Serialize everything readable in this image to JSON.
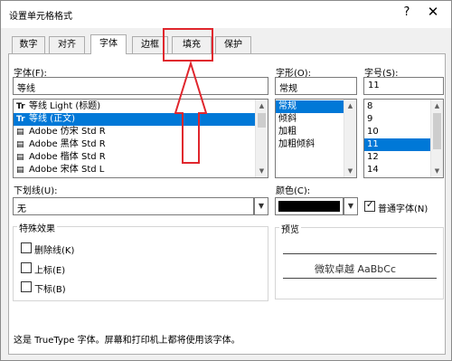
{
  "dialog": {
    "title": "设置单元格格式",
    "help": "?",
    "close": "✕"
  },
  "tabs": [
    {
      "label": "数字"
    },
    {
      "label": "对齐"
    },
    {
      "label": "字体"
    },
    {
      "label": "边框"
    },
    {
      "label": "填充"
    },
    {
      "label": "保护"
    }
  ],
  "font": {
    "label": "字体(F):",
    "value": "等线",
    "items": [
      {
        "glyph": "Tr",
        "label": "等线 Light (标题)"
      },
      {
        "glyph": "Tr",
        "label": "等线 (正文)"
      },
      {
        "glyph": "▤",
        "label": "Adobe 仿宋 Std R"
      },
      {
        "glyph": "▤",
        "label": "Adobe 黑体 Std R"
      },
      {
        "glyph": "▤",
        "label": "Adobe 楷体 Std R"
      },
      {
        "glyph": "▤",
        "label": "Adobe 宋体 Std L"
      }
    ]
  },
  "style": {
    "label": "字形(O):",
    "value": "常规",
    "items": [
      {
        "label": "常规"
      },
      {
        "label": "倾斜"
      },
      {
        "label": "加粗"
      },
      {
        "label": "加粗倾斜"
      }
    ]
  },
  "size": {
    "label": "字号(S):",
    "value": "11",
    "items": [
      {
        "label": "8"
      },
      {
        "label": "9"
      },
      {
        "label": "10"
      },
      {
        "label": "11"
      },
      {
        "label": "12"
      },
      {
        "label": "14"
      }
    ]
  },
  "underline": {
    "label": "下划线(U):",
    "value": "无"
  },
  "color": {
    "label": "颜色(C):",
    "swatch": "#000000",
    "normal_font_label": "普通字体(N)"
  },
  "effects": {
    "title": "特殊效果",
    "strikethrough": "删除线(K)",
    "superscript": "上标(E)",
    "subscript": "下标(B)"
  },
  "preview": {
    "title": "预览",
    "sample": "微软卓越  AaBbCc"
  },
  "footer_text": "这是 TrueType 字体。屏幕和打印机上都将使用该字体。",
  "colors": {
    "highlight": "#e0262d",
    "selection": "#0078d7"
  }
}
